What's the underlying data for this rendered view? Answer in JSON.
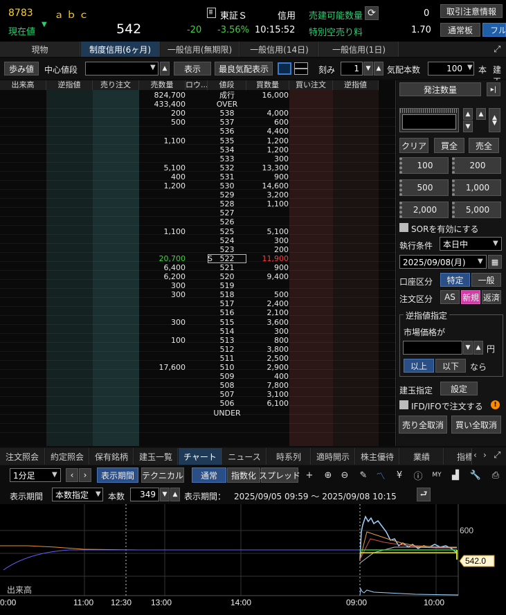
{
  "header": {
    "code": "8783",
    "name": "ａｂｃ",
    "price_label": "現在値",
    "price": "542",
    "change": "-20",
    "change_pct": "-3.56%",
    "time": "10:15:52",
    "exchange": "東証Ｓ",
    "credit": "信用",
    "short_avail_label": "売建可能数量",
    "short_avail_value": "0",
    "special_short_fee_label": "特別空売り料",
    "special_short_fee_value": "1.70",
    "caution_info_button": "取引注意情報",
    "normal_board_button": "通常板",
    "full_board_button": "フル"
  },
  "tabs": [
    {
      "label": "現物",
      "active": false
    },
    {
      "label": "制度信用(6ヶ月)",
      "active": true
    },
    {
      "label": "一般信用(無期限)",
      "active": false
    },
    {
      "label": "一般信用(14日)",
      "active": false
    },
    {
      "label": "一般信用(1日)",
      "active": false
    }
  ],
  "toolbar": {
    "tick_button": "歩み値",
    "center_price_label": "中心値段",
    "center_price_value": "",
    "show_button": "表示",
    "best_quote_button": "最良気配表示",
    "step_label": "刻み",
    "step_value": "1",
    "quote_count_label": "気配本数",
    "quote_count_value": "100",
    "unit_label": "本",
    "position_cut": "建玉"
  },
  "orderbook": {
    "headers": [
      "出来高",
      "逆指値",
      "売り注文",
      "売数量",
      "ロウ...",
      "値段",
      "買数量",
      "買い注文",
      "逆指値"
    ],
    "rows": [
      {
        "sell": "824,700",
        "price": "成行",
        "buy": "16,000"
      },
      {
        "sell": "433,400",
        "price": "OVER",
        "buy": ""
      },
      {
        "sell": "200",
        "price": "538",
        "buy": "4,000"
      },
      {
        "sell": "500",
        "price": "537",
        "buy": "600"
      },
      {
        "sell": "",
        "price": "536",
        "buy": "4,400"
      },
      {
        "sell": "1,100",
        "price": "535",
        "buy": "1,200"
      },
      {
        "sell": "",
        "price": "534",
        "buy": "1,200"
      },
      {
        "sell": "",
        "price": "533",
        "buy": "300"
      },
      {
        "sell": "5,100",
        "price": "532",
        "buy": "13,300"
      },
      {
        "sell": "400",
        "price": "531",
        "buy": "900"
      },
      {
        "sell": "1,200",
        "price": "530",
        "buy": "14,600"
      },
      {
        "sell": "",
        "price": "529",
        "buy": "3,200"
      },
      {
        "sell": "",
        "price": "528",
        "buy": "1,100"
      },
      {
        "sell": "",
        "price": "527",
        "buy": ""
      },
      {
        "sell": "",
        "price": "526",
        "buy": ""
      },
      {
        "sell": "1,100",
        "price": "525",
        "buy": "5,100"
      },
      {
        "sell": "",
        "price": "524",
        "buy": "300"
      },
      {
        "sell": "",
        "price": "523",
        "buy": "200"
      },
      {
        "sell": "20,700",
        "price": "522",
        "buy": "11,900",
        "marker": "S",
        "highlight": true
      },
      {
        "sell": "6,400",
        "price": "521",
        "buy": "900"
      },
      {
        "sell": "6,200",
        "price": "520",
        "buy": "9,400"
      },
      {
        "sell": "300",
        "price": "519",
        "buy": ""
      },
      {
        "sell": "300",
        "price": "518",
        "buy": "500"
      },
      {
        "sell": "",
        "price": "517",
        "buy": "2,400"
      },
      {
        "sell": "",
        "price": "516",
        "buy": "2,100"
      },
      {
        "sell": "300",
        "price": "515",
        "buy": "3,600"
      },
      {
        "sell": "",
        "price": "514",
        "buy": "300"
      },
      {
        "sell": "100",
        "price": "513",
        "buy": "800"
      },
      {
        "sell": "",
        "price": "512",
        "buy": "3,800"
      },
      {
        "sell": "",
        "price": "511",
        "buy": "2,500"
      },
      {
        "sell": "17,600",
        "price": "510",
        "buy": "2,900"
      },
      {
        "sell": "",
        "price": "509",
        "buy": "400"
      },
      {
        "sell": "",
        "price": "508",
        "buy": "7,800"
      },
      {
        "sell": "",
        "price": "507",
        "buy": "3,100"
      },
      {
        "sell": "",
        "price": "506",
        "buy": "6,100"
      },
      {
        "sell": "",
        "price": "UNDER",
        "buy": ""
      }
    ]
  },
  "order_panel": {
    "qty_button": "発注数量",
    "qty_value": "",
    "clear": "クリア",
    "buy_all": "買全",
    "sell_all": "売全",
    "qty_presets": [
      "100",
      "200",
      "500",
      "1,000",
      "2,000",
      "5,000"
    ],
    "sor_label": "SORを有効にする",
    "exec_cond_label": "執行条件",
    "exec_cond_value": "本日中",
    "date_value": "2025/09/08(月)",
    "account_label": "口座区分",
    "account_specific": "特定",
    "account_general": "一般",
    "order_type_label": "注文区分",
    "order_as": "AS",
    "order_new": "新規",
    "order_close": "返済",
    "stop_title": "逆指値指定",
    "market_price_label": "市場価格が",
    "stop_price": "",
    "yen": "円",
    "above": "以上",
    "below": "以下",
    "then": "なら",
    "position_label": "建玉指定",
    "position_button": "設定",
    "ifd_label": "IFD/IFOで注文する",
    "sell_cancel_all": "売り全取消",
    "buy_cancel_all": "買い全取消"
  },
  "bottom_tabs": [
    {
      "label": "注文照会",
      "active": false
    },
    {
      "label": "約定照会",
      "active": false
    },
    {
      "label": "保有銘柄",
      "active": false
    },
    {
      "label": "建玉一覧",
      "active": false
    },
    {
      "label": "チャート",
      "active": true
    },
    {
      "label": "ニュース",
      "active": false
    },
    {
      "label": "時系列",
      "active": false
    },
    {
      "label": "適時開示",
      "active": false
    },
    {
      "label": "株主優待",
      "active": false
    },
    {
      "label": "業績",
      "active": false
    },
    {
      "label": "指標",
      "active": false
    }
  ],
  "chart_toolbar": {
    "interval": "1分足",
    "period_button": "表示期間",
    "technical_button": "テクニカル",
    "normal_button": "通常",
    "index_button": "指数化",
    "spread_button": "スプレッド",
    "period_label": "表示期間",
    "period_mode": "本数指定",
    "count_label": "本数",
    "count_value": "349",
    "range_label": "表示期間：",
    "range_value": "2025/09/05 09:59 ～ 2025/09/08 10:15"
  },
  "chart": {
    "y_tick": "600",
    "last_price_label": "542.0",
    "volume_label": "出来高",
    "x_ticks": [
      "0:00",
      "11:00",
      "12:30",
      "13:00",
      "14:00",
      "09:00",
      "10:00"
    ]
  },
  "colors": {
    "accent": "#1f3a57",
    "up": "#3fd43f",
    "down": "#ff3b3b",
    "header_yellow": "#ffd21f",
    "label_green": "#2ecc71"
  }
}
